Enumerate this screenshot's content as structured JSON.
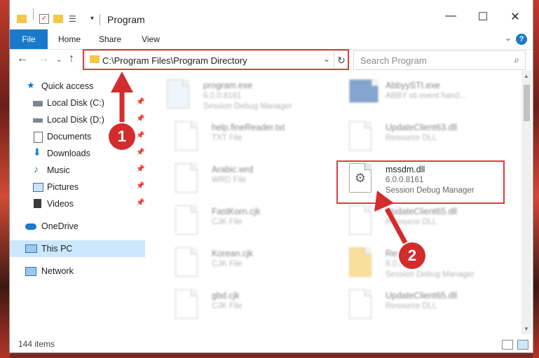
{
  "window": {
    "title": "Program",
    "controls": {
      "minimize": "—",
      "maximize": "☐",
      "close": "✕"
    }
  },
  "ribbon": {
    "tabs": [
      "File",
      "Home",
      "Share",
      "View"
    ],
    "help": "?"
  },
  "nav": {
    "address": "C:\\Program Files\\Program Directory",
    "search_placeholder": "Search Program"
  },
  "sidebar": {
    "items": [
      {
        "label": "Quick access",
        "icon": "star-icon"
      },
      {
        "label": "Local Disk (C:)",
        "icon": "drive-icon",
        "pinned": true
      },
      {
        "label": "Local Disk (D:)",
        "icon": "drive-icon",
        "pinned": true
      },
      {
        "label": "Documents",
        "icon": "documents-icon",
        "pinned": true
      },
      {
        "label": "Downloads",
        "icon": "download-icon",
        "pinned": true
      },
      {
        "label": "Music",
        "icon": "music-icon",
        "pinned": true
      },
      {
        "label": "Pictures",
        "icon": "pictures-icon",
        "pinned": true
      },
      {
        "label": "Videos",
        "icon": "videos-icon",
        "pinned": true
      },
      {
        "label": "OneDrive",
        "icon": "cloud-icon"
      },
      {
        "label": "This PC",
        "icon": "computer-icon",
        "selected": true
      },
      {
        "label": "Network",
        "icon": "network-icon"
      }
    ]
  },
  "files": [
    {
      "name": "program.exe",
      "line2": "6.0.0.8161",
      "line3": "Session Debug Manager"
    },
    {
      "name": "AbbyySTI.exe",
      "line2": "ABBY sti event hand...",
      "line3": ""
    },
    {
      "name": "help.fineReader.txt",
      "line2": "TXT File",
      "line3": ""
    },
    {
      "name": "UpdateClient63.dll",
      "line2": "Resource DLL",
      "line3": ""
    },
    {
      "name": "Arabic.wrd",
      "line2": "WRD File",
      "line3": ""
    },
    {
      "name": "mssdm.dll",
      "line2": "6.0.0.8161",
      "line3": "Session Debug Manager"
    },
    {
      "name": "FastKorn.cjk",
      "line2": "CJK File",
      "line3": ""
    },
    {
      "name": "UpdateClient65.dll",
      "line2": "Resource DLL",
      "line3": ""
    },
    {
      "name": "Korean.cjk",
      "line2": "CJK File",
      "line3": ""
    },
    {
      "name": "Resource",
      "line2": "6.0.0.8161",
      "line3": "Session Debug Manager"
    },
    {
      "name": "gbd.cjk",
      "line2": "CJK File",
      "line3": ""
    },
    {
      "name": "UpdateClient65.dll",
      "line2": "Resource DLL",
      "line3": ""
    }
  ],
  "status": {
    "count": "144 items"
  },
  "callouts": [
    "1",
    "2"
  ],
  "colors": {
    "accent": "#1979ca",
    "annotation": "#e03c3c",
    "selected": "#cce8ff"
  }
}
